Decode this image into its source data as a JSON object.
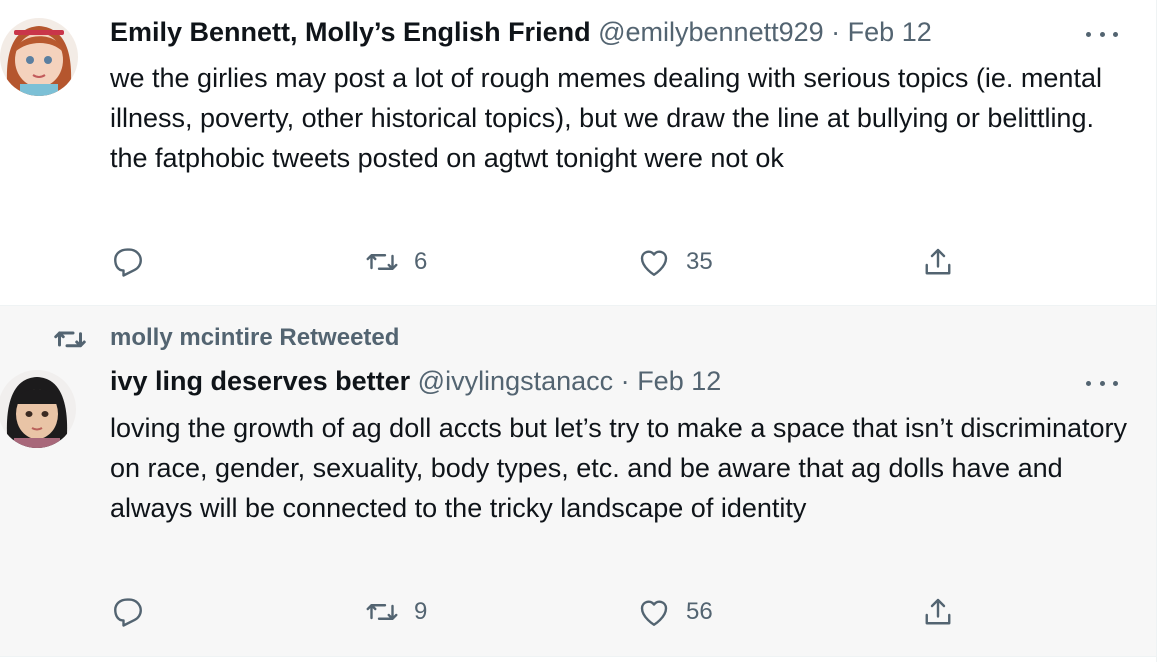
{
  "tweets": [
    {
      "display_name": "Emily Bennett, Molly’s English Friend",
      "handle": "@emilybennett929",
      "separator": "·",
      "date": "Feb 12",
      "text": "we the girlies may post a lot of rough memes dealing with serious topics (ie. mental illness, poverty, other historical topics), but we draw the line at bullying or belittling. the fatphobic tweets posted on agtwt tonight were not ok",
      "replies": "",
      "retweets": "6",
      "likes": "35",
      "avatar_icon": "doll-avatar-redhair"
    },
    {
      "retweeted_by": "molly mcintire Retweeted",
      "display_name": "ivy ling deserves better",
      "handle": "@ivylingstanacc",
      "separator": "·",
      "date": "Feb 12",
      "text": "loving the growth of ag doll accts but let’s try to make a space that isn’t discriminatory on race, gender, sexuality, body types, etc. and be aware that ag dolls have and always will be connected to the tricky landscape of identity",
      "replies": "",
      "retweets": "9",
      "likes": "56",
      "avatar_icon": "doll-avatar-blackhair"
    }
  ],
  "icons": {
    "reply": "reply-icon",
    "retweet": "retweet-icon",
    "like": "heart-icon",
    "share": "share-icon",
    "more": "more-icon"
  },
  "colors": {
    "text": "#0f1419",
    "muted": "#536471",
    "retweet_bg": "#f7f7f7"
  }
}
